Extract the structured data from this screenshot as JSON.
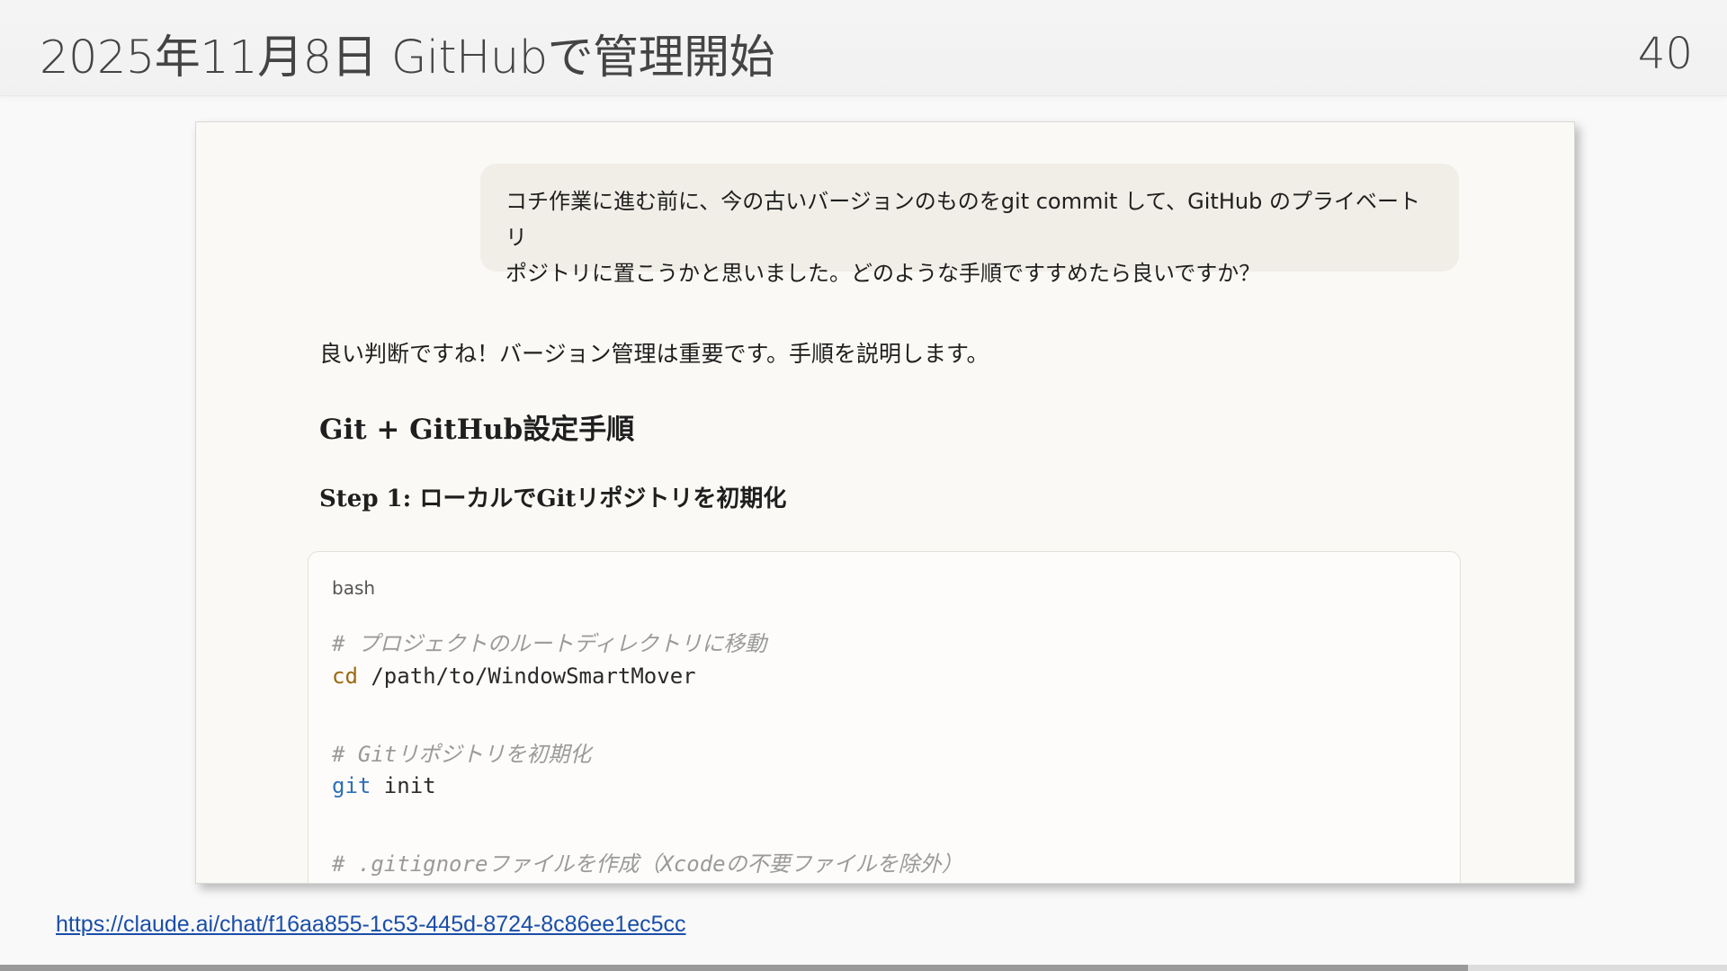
{
  "slide": {
    "title": "2025年11月8日 GitHubで管理開始",
    "page_number": "40",
    "progress": 0.85
  },
  "chat": {
    "user_message_line1": "コチ作業に進む前に、今の古いバージョンのものをgit commit して、GitHub のプライベートリ",
    "user_message_line2": "ポジトリに置こうかと思いました。どのような手順ですすめたら良いですか？",
    "assistant_intro": "良い判断ですね！バージョン管理は重要です。手順を説明します。",
    "assistant_heading": "Git + GitHub設定手順",
    "step_label": "Step 1:",
    "step_text": "ローカルでGitリポジトリを初期化",
    "code": {
      "language": "bash",
      "comment1": "# プロジェクトのルートディレクトリに移動",
      "cmd1_keyword": "cd",
      "cmd1_rest": " /path/to/WindowSmartMover",
      "comment2": "# Gitリポジトリを初期化",
      "cmd2_keyword": "git",
      "cmd2_rest": " init",
      "comment3": "# .gitignoreファイルを作成（Xcodeの不要ファイルを除外）"
    }
  },
  "footer": {
    "link_text": "https://claude.ai/chat/f16aa855-1c53-445d-8724-8c86ee1ec5cc"
  }
}
